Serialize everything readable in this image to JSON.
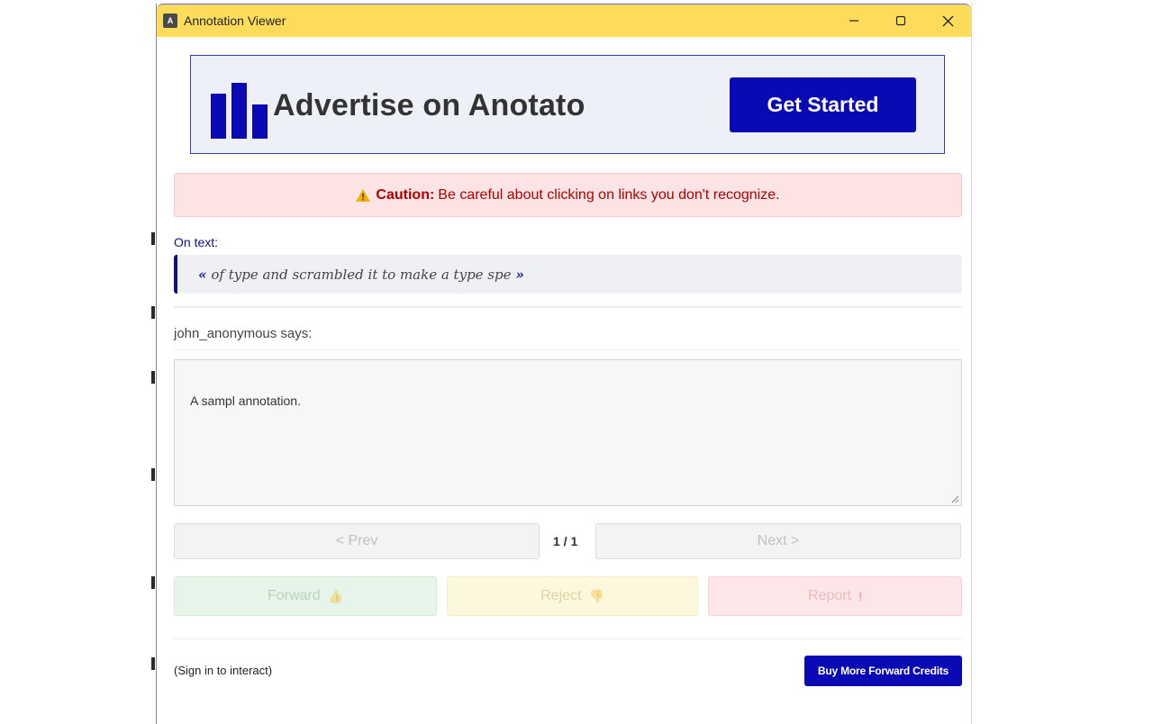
{
  "window": {
    "icon_letter": "A",
    "title": "Annotation Viewer"
  },
  "ad": {
    "text": "Advertise on Anotato",
    "cta_label": "Get Started",
    "brand_color": "#0a0ab5"
  },
  "caution": {
    "label": "Caution:",
    "message": "Be careful about clicking on links you don't recognize."
  },
  "annotation": {
    "on_text_label": "On text:",
    "open_quote": "«",
    "quoted_text": "of type and scrambled it to make a type spe",
    "close_quote": "»",
    "author_line": "john_anonymous says:",
    "body": "A sampl annotation."
  },
  "pager": {
    "prev_label": "< Prev",
    "count": "1 / 1",
    "next_label": "Next >"
  },
  "actions": {
    "forward_label": "Forward",
    "forward_icon": "👍",
    "reject_label": "Reject",
    "reject_icon": "👎",
    "report_label": "Report",
    "report_icon": "!"
  },
  "footer": {
    "signin_text": "(Sign in to interact)",
    "buy_credits_label": "Buy More Forward Credits"
  },
  "colors": {
    "titlebar": "#fddc5c",
    "accent": "#0a0ab5",
    "caution_text": "#b00000",
    "caution_bg": "#fde4e4"
  }
}
